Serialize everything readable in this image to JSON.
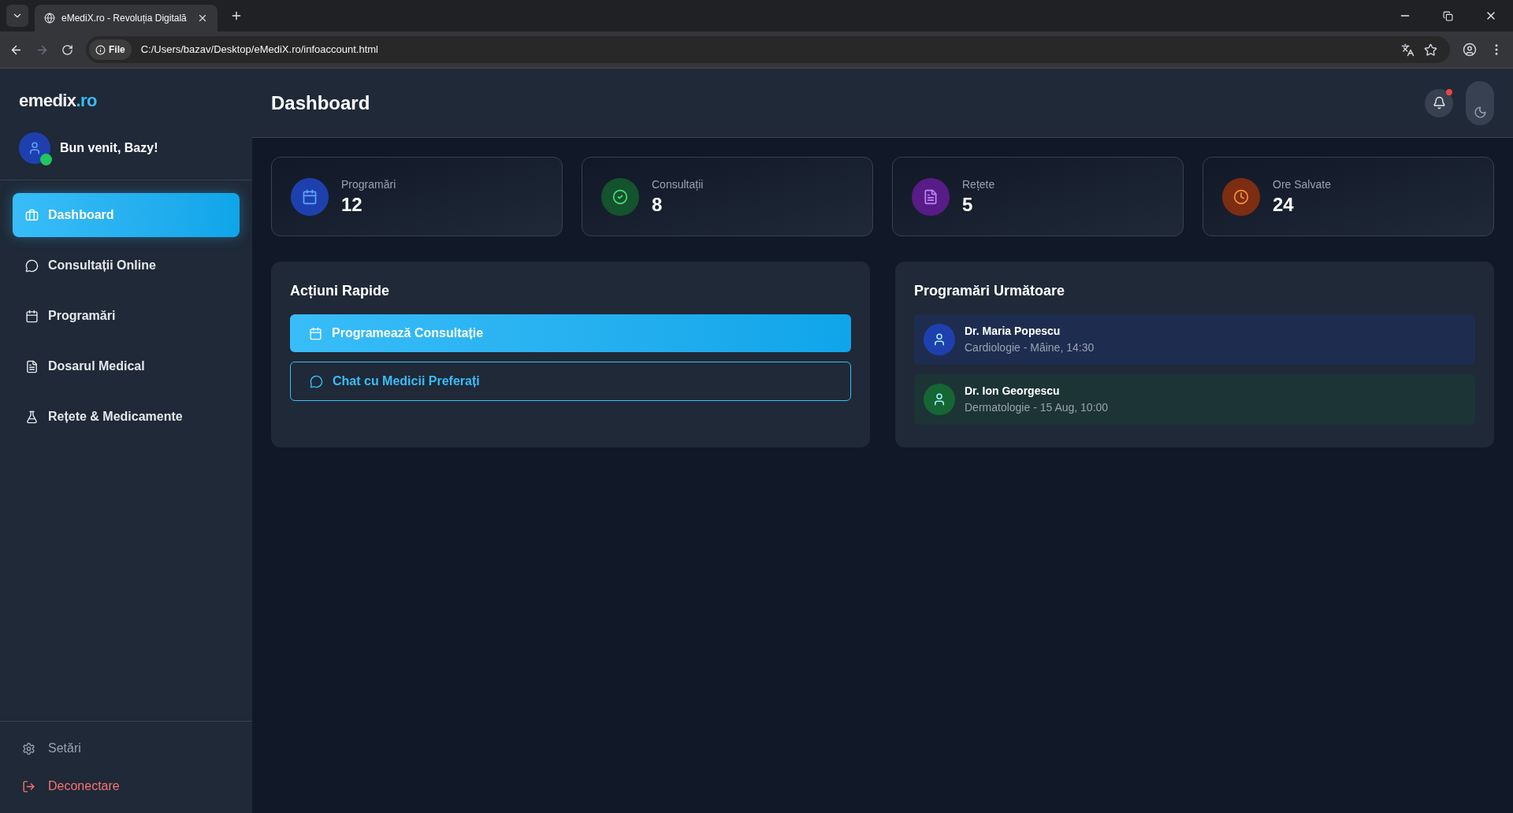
{
  "browser": {
    "tab_title": "eMediX.ro - Revoluția Digitală",
    "address_badge": "File",
    "url": "C:/Users/bazav/Desktop/eMediX.ro/infoaccount.html"
  },
  "sidebar": {
    "logo": {
      "name": "emedix",
      "suffix": ".ro"
    },
    "greeting": "Bun venit, Bazy!",
    "online": true,
    "items": [
      {
        "label": "Dashboard",
        "kind": "dashboard",
        "selected": true
      },
      {
        "label": "Consultații Online",
        "kind": "chat",
        "selected": false
      },
      {
        "label": "Programări",
        "kind": "calendar",
        "selected": false
      },
      {
        "label": "Dosarul Medical",
        "kind": "file",
        "selected": false
      },
      {
        "label": "Rețete & Medicamente",
        "kind": "flask",
        "selected": false
      }
    ],
    "footer": [
      {
        "label": "Setări",
        "kind": "settings"
      },
      {
        "label": "Deconectare",
        "kind": "logout"
      }
    ]
  },
  "header": {
    "title": "Dashboard",
    "notifications_unread": true
  },
  "stats": [
    {
      "label": "Programări",
      "value": "12",
      "kind": "calendar",
      "color": "#1e40af"
    },
    {
      "label": "Consultații",
      "value": "8",
      "kind": "check",
      "color": "#14532d"
    },
    {
      "label": "Rețete",
      "value": "5",
      "kind": "file",
      "color": "#581c87"
    },
    {
      "label": "Ore Salvate",
      "value": "24",
      "kind": "clock",
      "color": "#7c2d12"
    }
  ],
  "quick_actions": {
    "title": "Acțiuni Rapide",
    "buttons": [
      {
        "label": "Programează Consultație",
        "kind": "primary"
      },
      {
        "label": "Chat cu Medicii Preferați",
        "kind": "outline"
      }
    ]
  },
  "upcoming": {
    "title": "Programări Următoare",
    "items": [
      {
        "doctor": "Dr. Maria Popescu",
        "details": "Cardiologie - Mâine, 14:30",
        "color": "#1e40af"
      },
      {
        "doctor": "Dr. Ion Georgescu",
        "details": "Dermatologie - 15 Aug, 10:00",
        "color": "#166534"
      }
    ]
  }
}
